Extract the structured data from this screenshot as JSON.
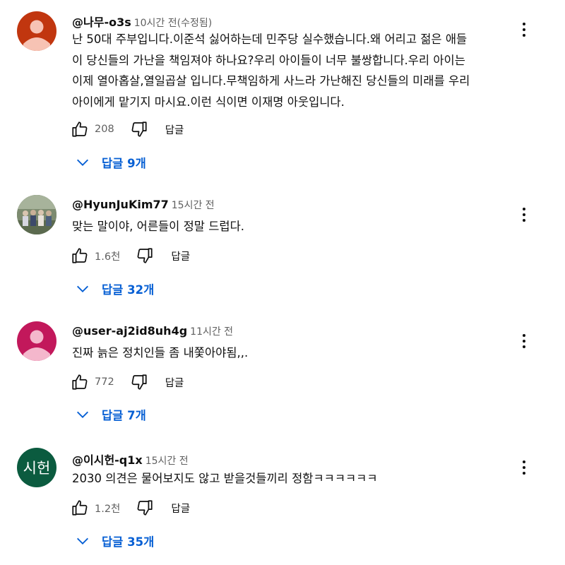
{
  "comments": [
    {
      "handle": "@나무-o3s",
      "time": "10시간 전(수정됨)",
      "avatar": {
        "type": "default",
        "bg": "#c1360f",
        "fg": "#f7c3b4"
      },
      "text": "난 50대 주부입니다.이준석 싫어하는데 민주당 실수했습니다.왜 어리고 젊은 애들\n이 당신들의 가난을 책임져야 하나요?우리 아이들이 너무 불쌍합니다.우리 아이는\n이제 열아홉살,열일곱살 입니다.무책임하게 사느라 가난해진 당신들의 미래를 우리\n아이에게 맡기지 마시요.이런 식이면 이재명 아웃입니다.",
      "likes": "208",
      "reply_label": "답글",
      "replies_label": "답글 9개"
    },
    {
      "handle": "@HyunJuKim77",
      "time": "15시간 전",
      "avatar": {
        "type": "photo",
        "bg": "#6e7f66",
        "fg": "#d9d2c3"
      },
      "text": "맞는 말이야, 어른들이 정말 드럽다.",
      "likes": "1.6천",
      "reply_label": "답글",
      "replies_label": "답글 32개"
    },
    {
      "handle": "@user-aj2id8uh4g",
      "time": "11시간 전",
      "avatar": {
        "type": "default",
        "bg": "#c2185b",
        "fg": "#f4b7cc"
      },
      "text": "진짜 늙은 정치인들 좀 내쫓아야됨,,.",
      "likes": "772",
      "reply_label": "답글",
      "replies_label": "답글 7개"
    },
    {
      "handle": "@이시헌-q1x",
      "time": "15시간 전",
      "avatar": {
        "type": "initials",
        "bg": "#0b5b3f",
        "initials": "시헌"
      },
      "text": "2030 의견은 물어보지도 않고 받을것들끼리 정함ㅋㅋㅋㅋㅋㅋ",
      "likes": "1.2천",
      "reply_label": "답글",
      "replies_label": "답글 35개"
    }
  ]
}
